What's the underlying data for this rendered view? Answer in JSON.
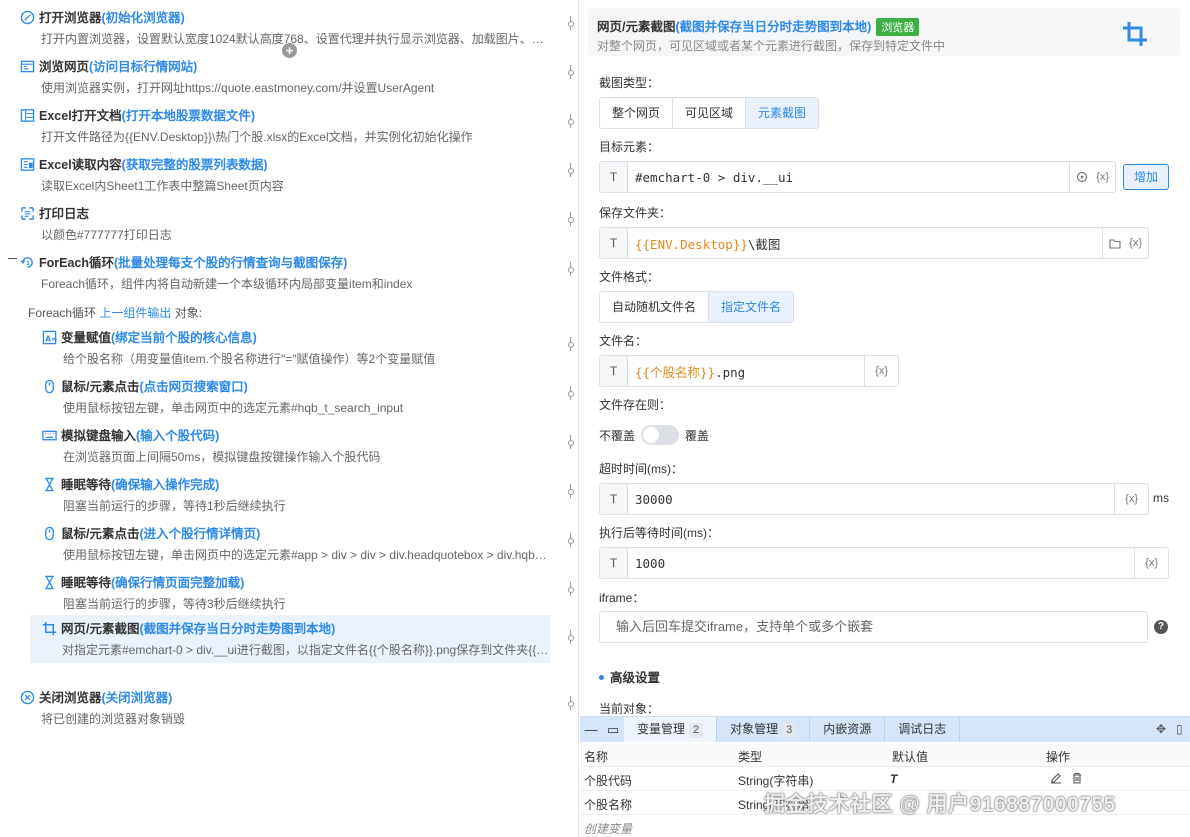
{
  "left": {
    "steps": [
      {
        "title": "打开浏览器",
        "subtitle": "(初始化浏览器)",
        "desc": "打开内置浏览器，设置默认宽度1024默认高度768、设置代理并执行显示浏览器、加载图片、…"
      },
      {
        "title": "浏览网页",
        "subtitle": "(访问目标行情网站)",
        "desc": "使用浏览器实例，打开网址https://quote.eastmoney.com/并设置UserAgent"
      },
      {
        "title": "Excel打开文档",
        "subtitle": "(打开本地股票数据文件)",
        "desc": "打开文件路径为{{ENV.Desktop}}\\热门个股.xlsx的Excel文档，并实例化初始化操作"
      },
      {
        "title": "Excel读取内容",
        "subtitle": "(获取完整的股票列表数据)",
        "desc": "读取Excel内Sheet1工作表中整篇Sheet页内容"
      },
      {
        "title": "打印日志",
        "subtitle": "",
        "desc": "以颜色#777777打印日志"
      },
      {
        "title": "ForEach循环",
        "subtitle": "(批量处理每支个股的行情查询与截图保存)",
        "desc": "Foreach循环，组件内将自动新建一个本级循环内局部变量item和index"
      }
    ],
    "foreach_header": {
      "prefix": "Foreach循环",
      "link": "上一组件输出",
      "suffix": "对象:"
    },
    "inner_steps": [
      {
        "title": "变量赋值",
        "subtitle": "(绑定当前个股的核心信息)",
        "desc": "给个股名称（用变量值item.个股名称进行\"=\"赋值操作）等2个变量赋值"
      },
      {
        "title": "鼠标/元素点击",
        "subtitle": "(点击网页搜索窗口)",
        "desc": "使用鼠标按钮左键，单击网页中的选定元素#hqb_t_search_input"
      },
      {
        "title": "模拟键盘输入",
        "subtitle": "(输入个股代码)",
        "desc": "在浏览器页面上间隔50ms，模拟键盘按键操作输入个股代码"
      },
      {
        "title": "睡眠等待",
        "subtitle": "(确保输入操作完成)",
        "desc": "阻塞当前运行的步骤，等待1秒后继续执行"
      },
      {
        "title": "鼠标/元素点击",
        "subtitle": "(进入个股行情详情页)",
        "desc": "使用鼠标按钮左键，单击网页中的选定元素#app > div > div > div.headquotebox > div.hqb…"
      },
      {
        "title": "睡眠等待",
        "subtitle": "(确保行情页面完整加载)",
        "desc": "阻塞当前运行的步骤，等待3秒后继续执行"
      },
      {
        "title": "网页/元素截图",
        "subtitle": "(截图并保存当日分时走势图到本地)",
        "desc": "对指定元素#emchart-0 > div.__ui进行截图，以指定文件名{{个股名称}}.png保存到文件夹{{…"
      }
    ],
    "last_step": {
      "title": "关闭浏览器",
      "subtitle": "(关闭浏览器)",
      "desc": "将已创建的浏览器对象销毁"
    }
  },
  "right": {
    "header": {
      "title": "网页/元素截图",
      "subtitle": "(截图并保存当日分时走势图到本地)",
      "badge": "浏览器",
      "desc": "对整个网页，可见区域或者某个元素进行截图，保存到特定文件中"
    },
    "shot_type": {
      "label": "截图类型：",
      "options": [
        "整个网页",
        "可见区域",
        "元素截图"
      ],
      "selected": "元素截图"
    },
    "target": {
      "label": "目标元素：",
      "type": "T",
      "value": "#emchart-0 > div.__ui",
      "vars": "{x}",
      "add": "增加"
    },
    "folder": {
      "label": "保存文件夹：",
      "type": "T",
      "var_part": "{{ENV.Desktop}}",
      "text_part": "\\截图",
      "vars": "{x}"
    },
    "format": {
      "label": "文件格式：",
      "options": [
        "自动随机文件名",
        "指定文件名"
      ],
      "selected": "指定文件名"
    },
    "filename": {
      "label": "文件名：",
      "type": "T",
      "var_part": "{{个股名称}}",
      "text_part": ".png",
      "vars": "{x}"
    },
    "exists": {
      "label": "文件存在则：",
      "off": "不覆盖",
      "on": "覆盖",
      "value": false
    },
    "timeout": {
      "label": "超时时间(ms)：",
      "type": "T",
      "value": "30000",
      "vars": "{x}",
      "unit": "ms"
    },
    "wait": {
      "label": "执行后等待时间(ms)：",
      "type": "T",
      "value": "1000",
      "vars": "{x}"
    },
    "iframe": {
      "label": "iframe：",
      "placeholder": "输入后回车提交iframe，支持单个或多个嵌套",
      "help": "?"
    },
    "advanced": "高级设置",
    "current_object": "当前对象："
  },
  "bottom": {
    "tabs": [
      {
        "label": "变量管理",
        "count": "2"
      },
      {
        "label": "对象管理",
        "count": "3"
      },
      {
        "label": "内嵌资源",
        "count": ""
      },
      {
        "label": "调试日志",
        "count": ""
      }
    ],
    "columns": [
      "名称",
      "类型",
      "默认值",
      "操作"
    ],
    "rows": [
      {
        "name": "个股代码",
        "type": "String(字符串)",
        "default": "T"
      },
      {
        "name": "个股名称",
        "type": "String(字符串)",
        "default": ""
      }
    ],
    "new_var": "创建变量"
  },
  "watermark": "掘金技术社区 @ 用户916887000755"
}
